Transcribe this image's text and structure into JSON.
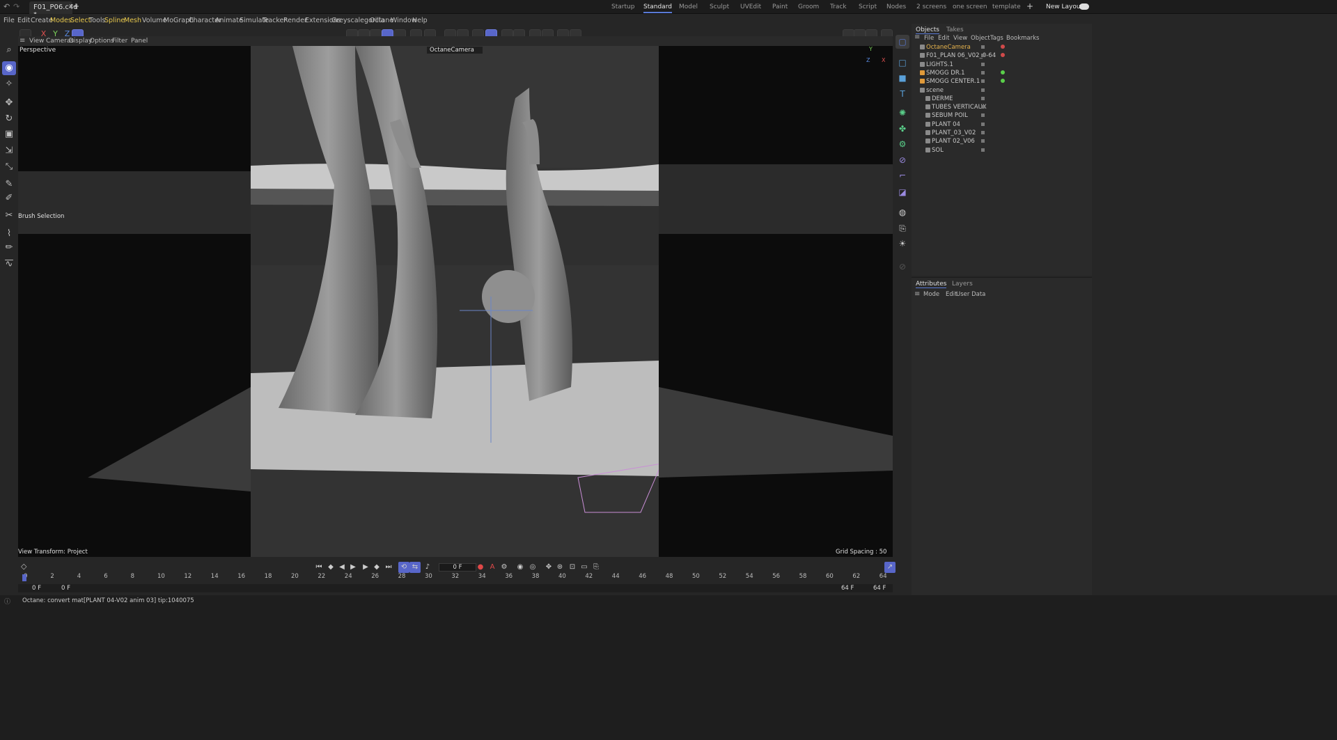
{
  "titlebar": {
    "file_tab": "F01_P06.c4d *",
    "layouts": [
      "Startup",
      "Standard",
      "Model",
      "Sculpt",
      "UVEdit",
      "Paint",
      "Groom",
      "Track",
      "Script",
      "Nodes",
      "2 screens",
      "one screen",
      "template"
    ],
    "active_layout": "Standard",
    "new_layouts": "New Layouts"
  },
  "menus": [
    "File",
    "Edit",
    "Create",
    "Modes",
    "Select",
    "Tools",
    "Spline",
    "Mesh",
    "Volume",
    "MoGraph",
    "Character",
    "Animate",
    "Simulate",
    "Tracker",
    "Render",
    "Extensions",
    "Greyscalegorilla",
    "Octane",
    "Window",
    "Help"
  ],
  "toolbar": {
    "axes": [
      "X",
      "Y",
      "Z"
    ]
  },
  "viewport_menu": [
    "View",
    "Cameras",
    "Display",
    "Options",
    "Filter",
    "Panel"
  ],
  "viewport": {
    "name": "Perspective",
    "camera": "OctaneCamera",
    "brush_selection": "Brush Selection",
    "view_transform": "View Transform: Project",
    "grid_spacing": "Grid Spacing : 50 cm"
  },
  "objects_panel": {
    "tabs": [
      "Objects",
      "Takes"
    ],
    "menu": [
      "File",
      "Edit",
      "View",
      "Object",
      "Tags",
      "Bookmarks"
    ],
    "items": [
      {
        "label": "OctaneCamera",
        "indent": 0,
        "color": "#e6b34d"
      },
      {
        "label": "F01_PLAN 06_V02_0-64",
        "indent": 0,
        "color": "#c8c8c8"
      },
      {
        "label": "LIGHTS.1",
        "indent": 0,
        "color": "#c8c8c8"
      },
      {
        "label": "SMOGG DR.1",
        "indent": 0,
        "color": "#c8c8c8"
      },
      {
        "label": "SMOGG CENTER.1",
        "indent": 0,
        "color": "#c8c8c8"
      },
      {
        "label": "scene",
        "indent": 0,
        "color": "#c8c8c8"
      },
      {
        "label": "DERME",
        "indent": 1,
        "color": "#c8c8c8"
      },
      {
        "label": "TUBES VERTICAUX",
        "indent": 1,
        "color": "#c8c8c8"
      },
      {
        "label": "SEBUM POIL",
        "indent": 1,
        "color": "#c8c8c8"
      },
      {
        "label": "PLANT 04",
        "indent": 1,
        "color": "#c8c8c8"
      },
      {
        "label": "PLANT_03_V02",
        "indent": 1,
        "color": "#c8c8c8"
      },
      {
        "label": "PLANT 02_V06",
        "indent": 1,
        "color": "#c8c8c8"
      },
      {
        "label": "SOL",
        "indent": 1,
        "color": "#c8c8c8"
      }
    ]
  },
  "attributes_panel": {
    "tabs": [
      "Attributes",
      "Layers"
    ],
    "menu": [
      "Mode",
      "Edit",
      "User Data"
    ]
  },
  "timeline": {
    "current_frame": "0 F",
    "ticks": [
      "0",
      "2",
      "4",
      "6",
      "8",
      "10",
      "12",
      "14",
      "16",
      "18",
      "20",
      "22",
      "24",
      "26",
      "28",
      "30",
      "32",
      "34",
      "36",
      "38",
      "40",
      "42",
      "44",
      "46",
      "48",
      "50",
      "52",
      "54",
      "56",
      "58",
      "60",
      "62",
      "64"
    ],
    "start_frame": "0 F",
    "start_frame_2": "0 F",
    "end_frame": "64 F",
    "end_frame_2": "64 F"
  },
  "status": {
    "message": "Octane:  convert mat[PLANT 04-V02 anim 03]  tip:1040075"
  }
}
